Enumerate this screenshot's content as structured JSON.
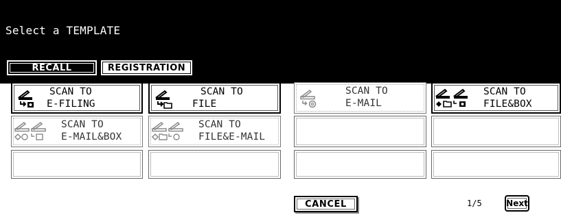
{
  "screen": {
    "title": "Select a TEMPLATE"
  },
  "tabs": [
    {
      "label": "RECALL",
      "active": true
    },
    {
      "label": "REGISTRATION",
      "active": false
    }
  ],
  "templates": [
    {
      "line1": "SCAN TO",
      "line2": "E-FILING",
      "icon": "scan-to-efiling-icon",
      "state": "enabled"
    },
    {
      "line1": "SCAN TO",
      "line2": "FILE",
      "icon": "scan-to-file-icon",
      "state": "enabled"
    },
    {
      "line1": "SCAN TO",
      "line2": "E-MAIL",
      "icon": "scan-to-email-icon",
      "state": "disabled"
    },
    {
      "line1": "SCAN TO",
      "line2": "FILE&BOX",
      "icon": "scan-to-file-and-box-icon",
      "state": "enabled"
    },
    {
      "line1": "SCAN TO",
      "line2": "E-MAIL&BOX",
      "icon": "scan-to-email-and-box-icon",
      "state": "disabled"
    },
    {
      "line1": "SCAN TO",
      "line2": "FILE&E-MAIL",
      "icon": "scan-to-file-and-email-icon",
      "state": "disabled"
    }
  ],
  "footer": {
    "cancel_label": "CANCEL",
    "page_indicator": "1/5",
    "next_label": "Next"
  },
  "colors": {
    "header_background": "#000000",
    "header_text": "#ffffff",
    "panel_background": "#ffffff"
  }
}
